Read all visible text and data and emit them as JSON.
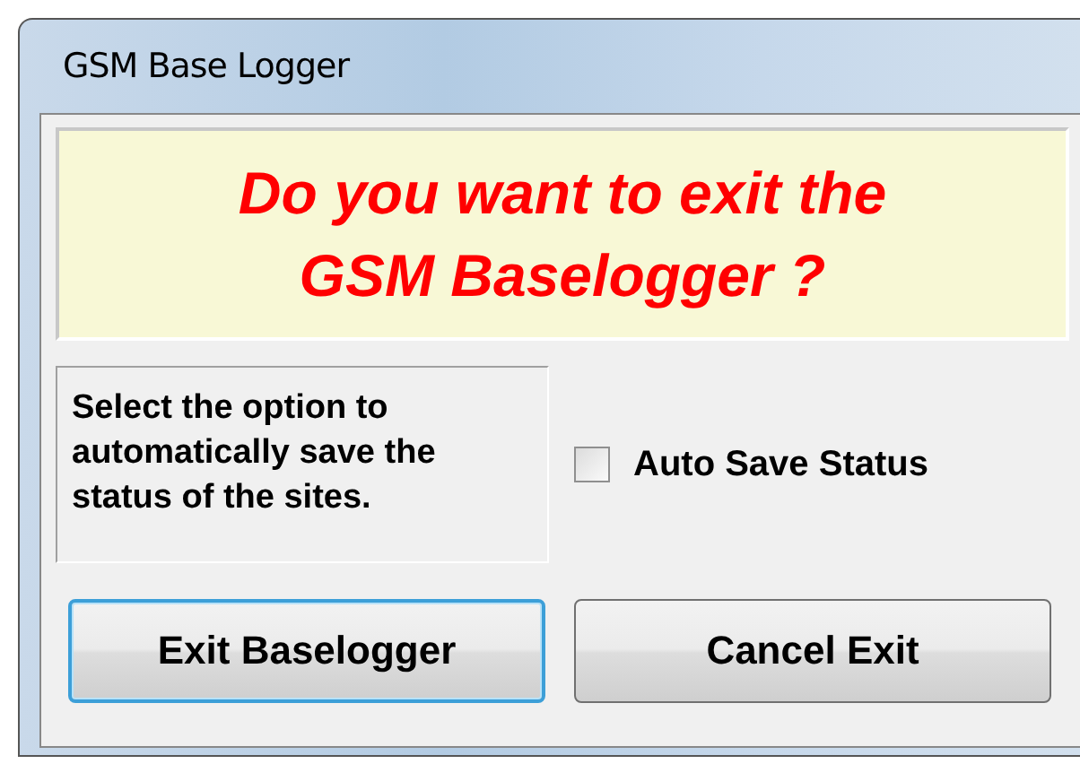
{
  "window": {
    "title": "GSM Base Logger"
  },
  "message": {
    "lines": [
      "Do you want to exit the",
      "GSM Baselogger ?"
    ]
  },
  "description": "Select the option to automatically save the status of the sites.",
  "auto_save": {
    "label": "Auto Save Status",
    "checked": false
  },
  "buttons": [
    {
      "label": "Exit Baselogger",
      "focused": true
    },
    {
      "label": "Cancel Exit",
      "focused": false
    }
  ]
}
